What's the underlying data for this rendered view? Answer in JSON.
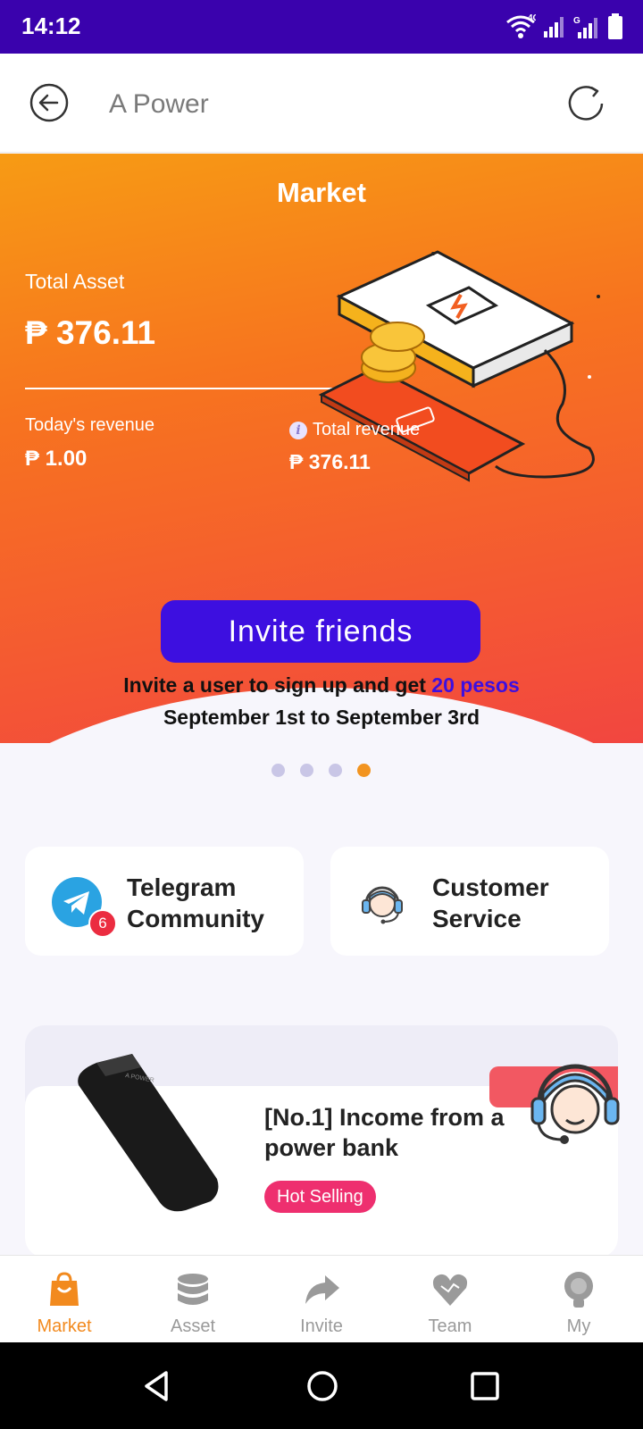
{
  "status": {
    "time": "14:12",
    "network": "4G",
    "signal2": "G"
  },
  "appbar": {
    "title": "A Power"
  },
  "hero": {
    "title": "Market",
    "total_asset_label": "Total Asset",
    "total_asset_value": "₱ 376.11",
    "today_revenue_label": "Today's revenue",
    "today_revenue_value": "₱ 1.00",
    "total_revenue_label": "Total revenue",
    "total_revenue_value": "₱ 376.11"
  },
  "banner": {
    "button": "Invite friends",
    "line1_prefix": "Invite a user to sign up and get ",
    "line1_highlight": "20 pesos",
    "line2": "September 1st to September 3rd",
    "dots": 4,
    "active_dot": 4
  },
  "cards": {
    "telegram": {
      "label": "Telegram\nCommunity",
      "badge": "6",
      "icon": "telegram-icon"
    },
    "service": {
      "label": "Customer\nService",
      "icon": "headset-icon"
    }
  },
  "product": {
    "name": "[No.1] Income from a power bank",
    "tag": "Hot Selling"
  },
  "tabs": [
    {
      "label": "Market",
      "icon": "shopping-bag-icon",
      "active": true
    },
    {
      "label": "Asset",
      "icon": "database-icon",
      "active": false
    },
    {
      "label": "Invite",
      "icon": "share-icon",
      "active": false
    },
    {
      "label": "Team",
      "icon": "heart-icon",
      "active": false
    },
    {
      "label": "My",
      "icon": "person-icon",
      "active": false
    }
  ],
  "colors": {
    "status_bar": "#3a02ad",
    "accent": "#f28a1e",
    "invite_button": "#3d0fe0",
    "hot_tag": "#ee2f6f"
  }
}
